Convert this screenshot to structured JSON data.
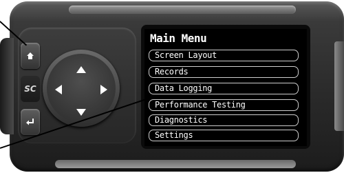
{
  "menu": {
    "title": "Main Menu",
    "items": [
      {
        "label": "Screen Layout"
      },
      {
        "label": "Records"
      },
      {
        "label": "Data Logging"
      },
      {
        "label": "Performance Testing"
      },
      {
        "label": "Diagnostics"
      },
      {
        "label": "Settings"
      }
    ]
  },
  "buttons": {
    "home_icon": "home-icon",
    "sc_label": "SC",
    "back_icon": "enter-return-icon"
  }
}
